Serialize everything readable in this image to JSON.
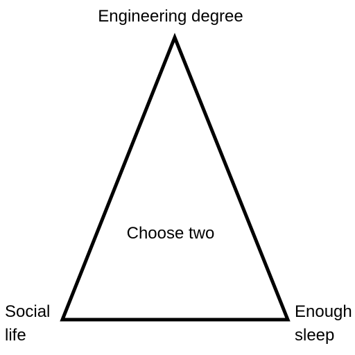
{
  "diagram": {
    "top_label": "Engineering degree",
    "center_label": "Choose two",
    "left_label": [
      "Social",
      "life"
    ],
    "right_label": [
      "Enough",
      "sleep"
    ],
    "stroke_color": "#000000",
    "background_color": "#ffffff"
  }
}
